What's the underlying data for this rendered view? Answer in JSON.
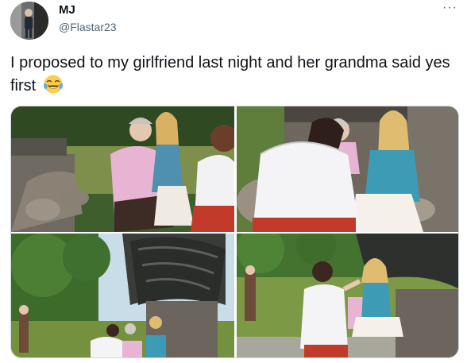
{
  "tweet": {
    "display_name": "MJ",
    "handle": "@Flastar23",
    "text": "I proposed to my girlfriend last night and her grandma said yes first",
    "emoji": "face-with-tears-of-joy-icon",
    "more_label": "···"
  },
  "colors": {
    "text": "#0f1419",
    "secondary": "#536471",
    "border": "#cfd9de"
  },
  "media": {
    "photos": [
      {
        "name": "photo-grandma-says-yes"
      },
      {
        "name": "photo-hugging-grandma"
      },
      {
        "name": "photo-kneeling-wide"
      },
      {
        "name": "photo-girlfriend-reaction"
      }
    ]
  }
}
